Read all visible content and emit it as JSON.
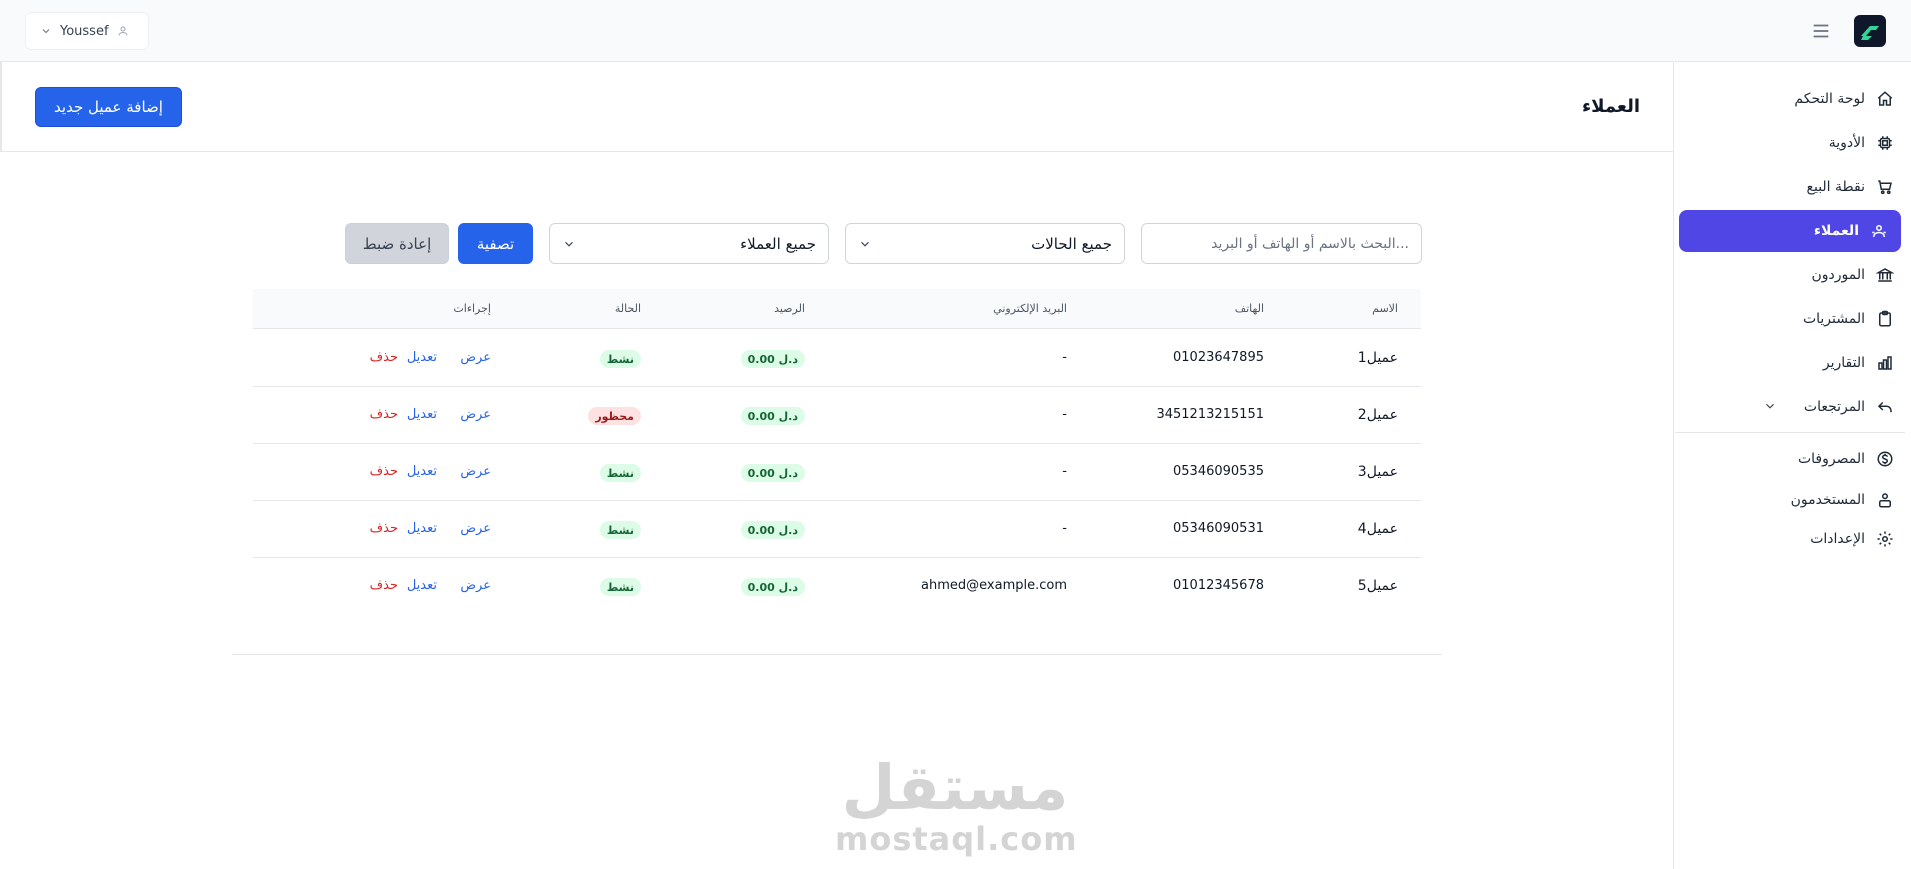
{
  "topbar": {
    "user_name": "Youssef"
  },
  "sidebar": {
    "items": [
      {
        "label": "لوحة التحكم",
        "icon": "home-icon"
      },
      {
        "label": "الأدوية",
        "icon": "chip-icon"
      },
      {
        "label": "نقطة البيع",
        "icon": "cart-icon"
      },
      {
        "label": "العملاء",
        "icon": "users-icon",
        "active": true
      },
      {
        "label": "الموردون",
        "icon": "bank-icon"
      },
      {
        "label": "المشتريات",
        "icon": "clipboard-icon"
      },
      {
        "label": "التقارير",
        "icon": "chart-icon"
      },
      {
        "label": "المرتجعات",
        "icon": "undo-icon"
      },
      {
        "label": "المصروفات",
        "icon": "dollar-icon"
      },
      {
        "label": "المستخدمون",
        "icon": "user-group-icon"
      },
      {
        "label": "الإعدادات",
        "icon": "gear-icon"
      }
    ]
  },
  "page": {
    "title": "العملاء",
    "add_button": "إضافة عميل جديد"
  },
  "filters": {
    "search_placeholder": "البحث بالاسم أو الهاتف أو البريد...",
    "status_select": "جميع الحالات",
    "type_select": "جميع العملاء",
    "filter_button": "تصفية",
    "reset_button": "إعادة ضبط"
  },
  "table": {
    "headers": {
      "name": "الاسم",
      "phone": "الهاتف",
      "email": "البريد الإلكتروني",
      "balance": "الرصيد",
      "status": "الحالة",
      "actions": "إجراءات"
    },
    "rows": [
      {
        "name": "عميل1",
        "phone": "01023647895",
        "email": "-",
        "balance": "0.00 د.ل",
        "status": "نشط",
        "status_type": "active"
      },
      {
        "name": "عميل2",
        "phone": "3451213215151",
        "email": "-",
        "balance": "0.00 د.ل",
        "status": "محظور",
        "status_type": "blocked"
      },
      {
        "name": "عميل3",
        "phone": "05346090535",
        "email": "-",
        "balance": "0.00 د.ل",
        "status": "نشط",
        "status_type": "active"
      },
      {
        "name": "عميل4",
        "phone": "05346090531",
        "email": "-",
        "balance": "0.00 د.ل",
        "status": "نشط",
        "status_type": "active"
      },
      {
        "name": "عميل5",
        "phone": "01012345678",
        "email": "ahmed@example.com",
        "balance": "0.00 د.ل",
        "status": "نشط",
        "status_type": "active"
      }
    ],
    "actions": {
      "view": "عرض",
      "edit": "تعديل",
      "delete": "حذف"
    }
  },
  "watermark": {
    "arabic": "مستقل",
    "english": "mostaql.com"
  },
  "colors": {
    "primary": "#2563eb",
    "sidebar_active": "#4f46e5",
    "danger": "#dc2626",
    "success_bg": "#dcfce7",
    "danger_bg": "#fee2e2"
  }
}
